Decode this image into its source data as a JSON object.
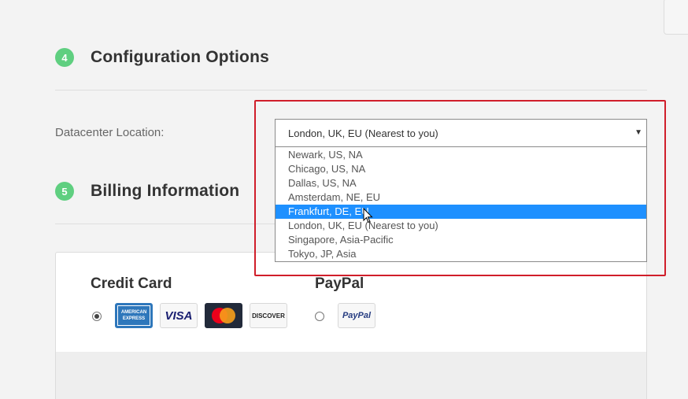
{
  "sections": {
    "config": {
      "number": "4",
      "title": "Configuration Options"
    },
    "billing": {
      "number": "5",
      "title": "Billing Information"
    }
  },
  "datacenter": {
    "label": "Datacenter Location:",
    "selected": "London, UK, EU (Nearest to you)",
    "options": [
      "Newark, US, NA",
      "Chicago, US, NA",
      "Dallas, US, NA",
      "Amsterdam, NE, EU",
      "Frankfurt, DE, EU",
      "London, UK, EU (Nearest to you)",
      "Singapore, Asia-Pacific",
      "Tokyo, JP, Asia"
    ],
    "highlighted_option": "Frankfurt, DE, EU"
  },
  "payment": {
    "credit_card_label": "Credit Card",
    "paypal_label": "PayPal",
    "selected_method": "Credit Card",
    "card_logos": {
      "amex_line1": "AMERICAN",
      "amex_line2": "EXPRESS",
      "visa": "VISA",
      "discover": "DISCOVER",
      "paypal": "PayPal"
    }
  },
  "colors": {
    "step_badge": "#5fcf80",
    "highlight_border": "#d01e2a",
    "selected_option": "#1e90ff"
  }
}
